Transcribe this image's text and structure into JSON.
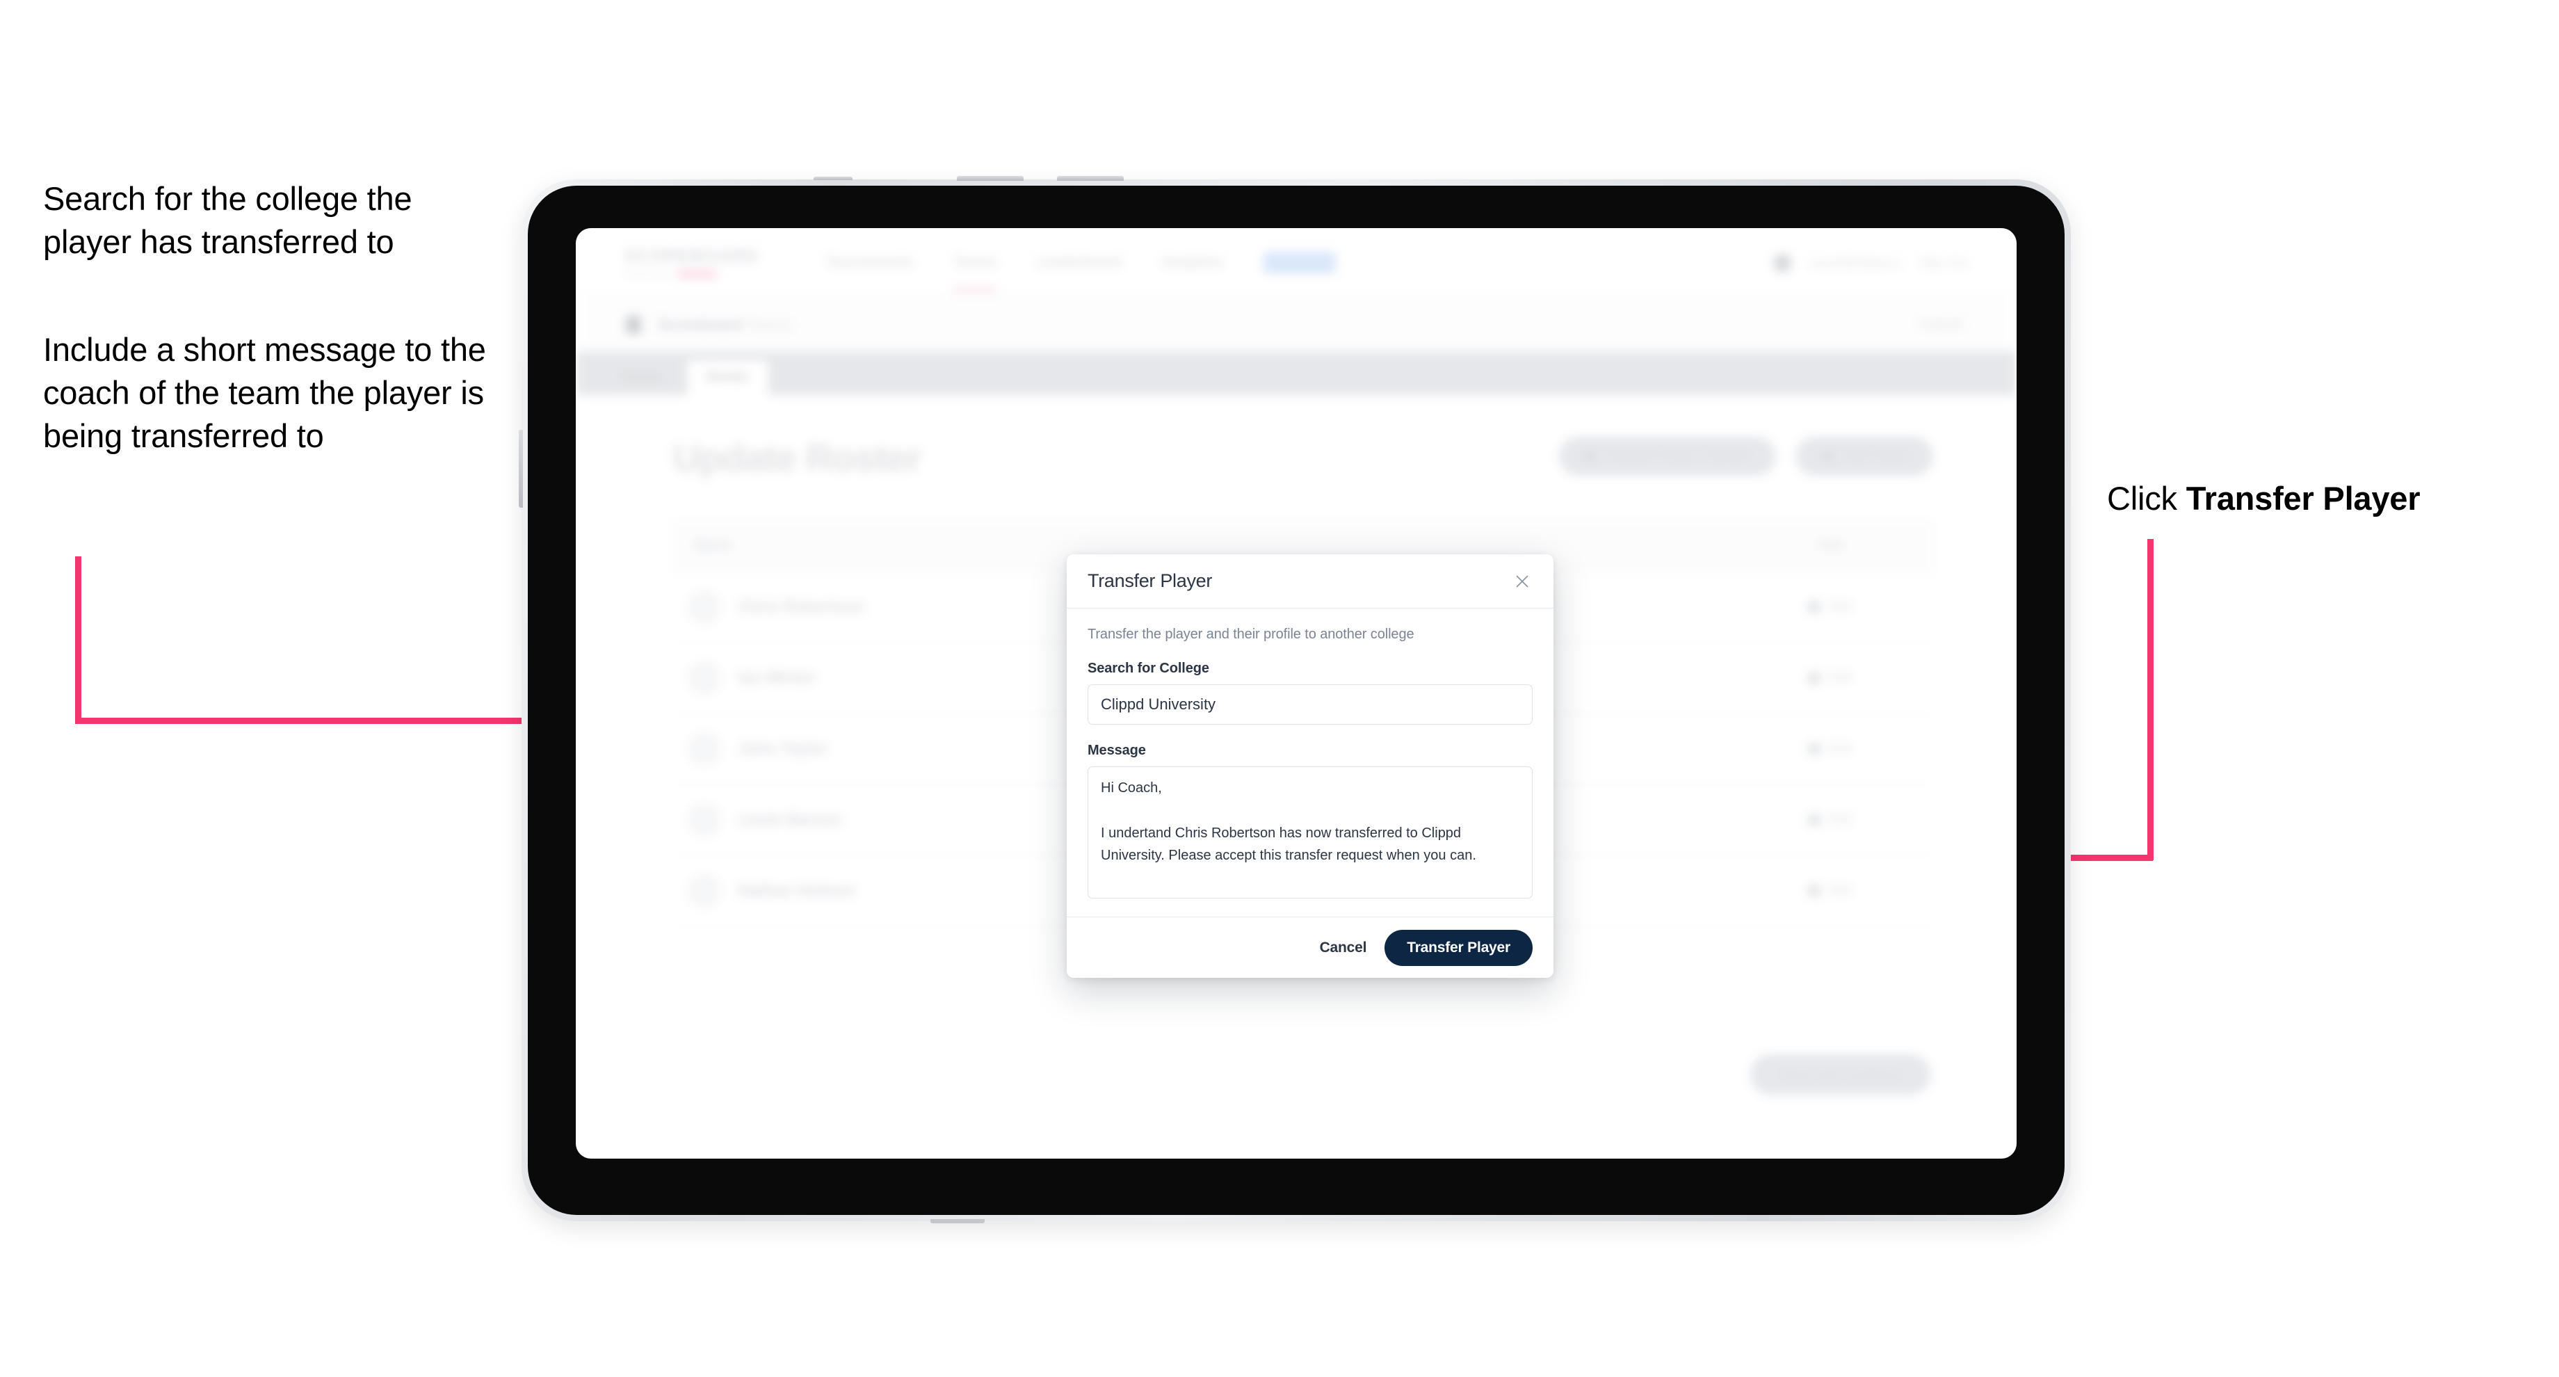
{
  "annotations": {
    "left_1": "Search for the college the player has transferred to",
    "left_2": "Include a short message to the coach of the team the player is being transferred to",
    "right_1_prefix": "Click ",
    "right_1_bold": "Transfer Player"
  },
  "colors": {
    "arrow": "#f4356e",
    "primary_button": "#0d2644",
    "text_dark": "#2b3545",
    "text_muted": "#7b8494",
    "border": "#dfe3e9",
    "device_bezel": "#0a0a0a"
  },
  "app": {
    "logo": {
      "main": "SCOREBOARD",
      "sub_left": "Powered by",
      "sub_pill": "Clippd"
    },
    "nav_items": [
      {
        "label": "Tournaments",
        "active": false
      },
      {
        "label": "Teams",
        "active": true
      },
      {
        "label": "Leaderboard",
        "active": false
      },
      {
        "label": "Analytics",
        "active": false
      }
    ],
    "nav_pill": "Roster",
    "nav_right": {
      "user": "coach@clippd.io",
      "signout": "Sign Out"
    },
    "subbar": {
      "crumb": "Scoreboard",
      "crumb_sub": "Teams",
      "cancel": "Cancel"
    },
    "tabs": [
      {
        "label": "Details",
        "active": false
      },
      {
        "label": "Roster",
        "active": true
      }
    ],
    "page_title": "Update Roster",
    "actions": [
      {
        "label": "Request Roster Transfer"
      },
      {
        "label": "Add Player"
      }
    ],
    "table": {
      "columns": [
        "Name",
        "Edit"
      ],
      "rows": [
        {
          "name": "Chris Robertson",
          "edit": "Edit"
        },
        {
          "name": "Ian Winter",
          "edit": "Edit"
        },
        {
          "name": "John Taylor",
          "edit": "Edit"
        },
        {
          "name": "Lewis Barnes",
          "edit": "Edit"
        },
        {
          "name": "Nathan Holmes",
          "edit": "Edit"
        }
      ]
    },
    "save_button": "Save And Continue"
  },
  "modal": {
    "title": "Transfer Player",
    "close_icon": "close-icon",
    "description": "Transfer the player and their profile to another college",
    "college_field": {
      "label": "Search for College",
      "value": "Clippd University",
      "placeholder": "Search for College"
    },
    "message_field": {
      "label": "Message",
      "value": "Hi Coach,\n\nI undertand Chris Robertson has now transferred to Clippd University. Please accept this transfer request when you can.",
      "placeholder": "Write a message"
    },
    "cancel_label": "Cancel",
    "submit_label": "Transfer Player"
  }
}
